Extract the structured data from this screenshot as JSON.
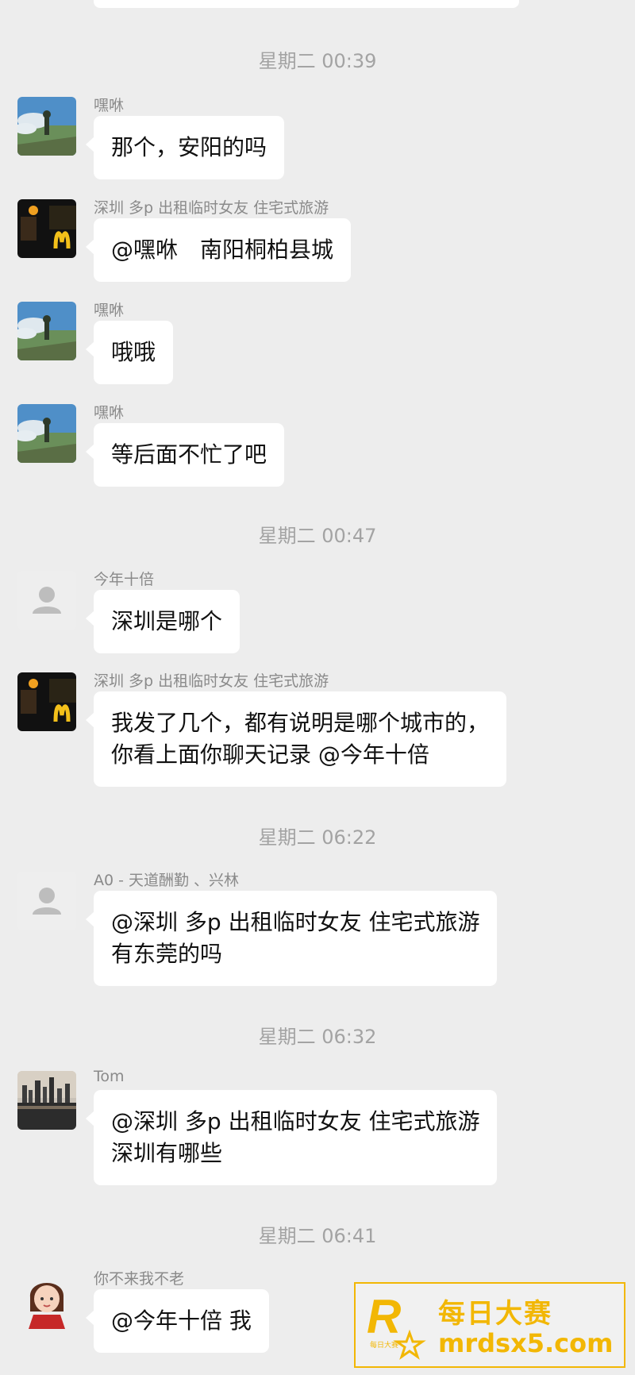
{
  "timestamps": [
    "星期二 00:39",
    "星期二 00:47",
    "星期二 06:22",
    "星期二 06:32",
    "星期二 06:41"
  ],
  "messages": [
    {
      "sender": "嘿咻",
      "avatar": "landscape-avatar-icon",
      "lines": [
        "那个，安阳的吗"
      ]
    },
    {
      "sender": "深圳 多p 出租临时女友 住宅式旅游",
      "avatar": "night-storefront-avatar-icon",
      "lines": [
        "@嘿咻　南阳桐柏县城"
      ]
    },
    {
      "sender": "嘿咻",
      "avatar": "landscape-avatar-icon",
      "lines": [
        "哦哦"
      ]
    },
    {
      "sender": "嘿咻",
      "avatar": "landscape-avatar-icon",
      "lines": [
        "等后面不忙了吧"
      ]
    },
    {
      "sender": "今年十倍",
      "avatar": "default-user-avatar-icon",
      "lines": [
        "深圳是哪个"
      ]
    },
    {
      "sender": "深圳 多p 出租临时女友 住宅式旅游",
      "avatar": "night-storefront-avatar-icon",
      "lines": [
        "我发了几个，都有说明是哪个城市的，",
        "你看上面你聊天记录 @今年十倍"
      ]
    },
    {
      "sender": "A0 - 天道酬勤 、兴林",
      "avatar": "default-user-avatar-icon",
      "lines": [
        "@深圳 多p 出租临时女友 住宅式旅游",
        "有东莞的吗"
      ]
    },
    {
      "sender": "Tom",
      "avatar": "city-skyline-avatar-icon",
      "lines": [
        "@深圳 多p 出租临时女友 住宅式旅游",
        "深圳有哪些"
      ]
    },
    {
      "sender": "你不来我不老",
      "avatar": "cartoon-girl-avatar-icon",
      "lines": [
        "@今年十倍 我"
      ]
    }
  ],
  "watermark": {
    "title": "每日大赛",
    "url": "mrdsx5.com",
    "logo_small_text": "每日大赛"
  }
}
